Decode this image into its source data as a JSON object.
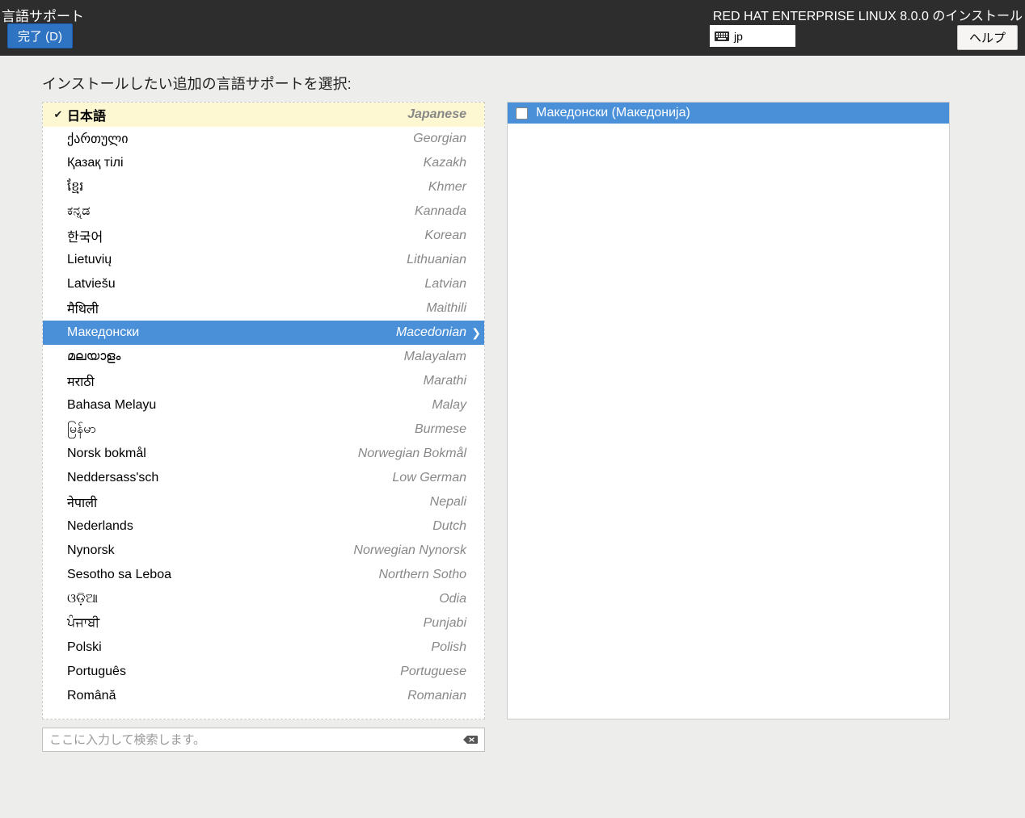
{
  "header": {
    "page_title": "言語サポート",
    "install_label": "RED HAT ENTERPRISE LINUX 8.0.0 のインストール",
    "done_button": "完了 (D)",
    "keyboard_layout": "jp",
    "help_button": "ヘルプ"
  },
  "instruction": "インストールしたい追加の言語サポートを選択:",
  "languages": [
    {
      "native": "日本語",
      "english": "Japanese",
      "checked": true,
      "selected": false
    },
    {
      "native": "ქართული",
      "english": "Georgian",
      "checked": false,
      "selected": false
    },
    {
      "native": "Қазақ тілі",
      "english": "Kazakh",
      "checked": false,
      "selected": false
    },
    {
      "native": "ខ្មែរ",
      "english": "Khmer",
      "checked": false,
      "selected": false
    },
    {
      "native": "ಕನ್ನಡ",
      "english": "Kannada",
      "checked": false,
      "selected": false
    },
    {
      "native": "한국어",
      "english": "Korean",
      "checked": false,
      "selected": false
    },
    {
      "native": "Lietuvių",
      "english": "Lithuanian",
      "checked": false,
      "selected": false
    },
    {
      "native": "Latviešu",
      "english": "Latvian",
      "checked": false,
      "selected": false
    },
    {
      "native": "मैथिली",
      "english": "Maithili",
      "checked": false,
      "selected": false
    },
    {
      "native": "Македонски",
      "english": "Macedonian",
      "checked": false,
      "selected": true
    },
    {
      "native": "മലയാളം",
      "english": "Malayalam",
      "checked": false,
      "selected": false
    },
    {
      "native": "मराठी",
      "english": "Marathi",
      "checked": false,
      "selected": false
    },
    {
      "native": "Bahasa Melayu",
      "english": "Malay",
      "checked": false,
      "selected": false
    },
    {
      "native": "မြန်မာ",
      "english": "Burmese",
      "checked": false,
      "selected": false
    },
    {
      "native": "Norsk bokmål",
      "english": "Norwegian Bokmål",
      "checked": false,
      "selected": false
    },
    {
      "native": "Neddersass'sch",
      "english": "Low German",
      "checked": false,
      "selected": false
    },
    {
      "native": "नेपाली",
      "english": "Nepali",
      "checked": false,
      "selected": false
    },
    {
      "native": "Nederlands",
      "english": "Dutch",
      "checked": false,
      "selected": false
    },
    {
      "native": "Nynorsk",
      "english": "Norwegian Nynorsk",
      "checked": false,
      "selected": false
    },
    {
      "native": "Sesotho sa Leboa",
      "english": "Northern Sotho",
      "checked": false,
      "selected": false
    },
    {
      "native": "ଓଡ଼ିଆ",
      "english": "Odia",
      "checked": false,
      "selected": false
    },
    {
      "native": "ਪੰਜਾਬੀ",
      "english": "Punjabi",
      "checked": false,
      "selected": false
    },
    {
      "native": "Polski",
      "english": "Polish",
      "checked": false,
      "selected": false
    },
    {
      "native": "Português",
      "english": "Portuguese",
      "checked": false,
      "selected": false
    },
    {
      "native": "Română",
      "english": "Romanian",
      "checked": false,
      "selected": false
    }
  ],
  "locales": [
    {
      "label": "Македонски (Македонија)",
      "checked": false
    }
  ],
  "search": {
    "placeholder": "ここに入力して検索します。"
  }
}
